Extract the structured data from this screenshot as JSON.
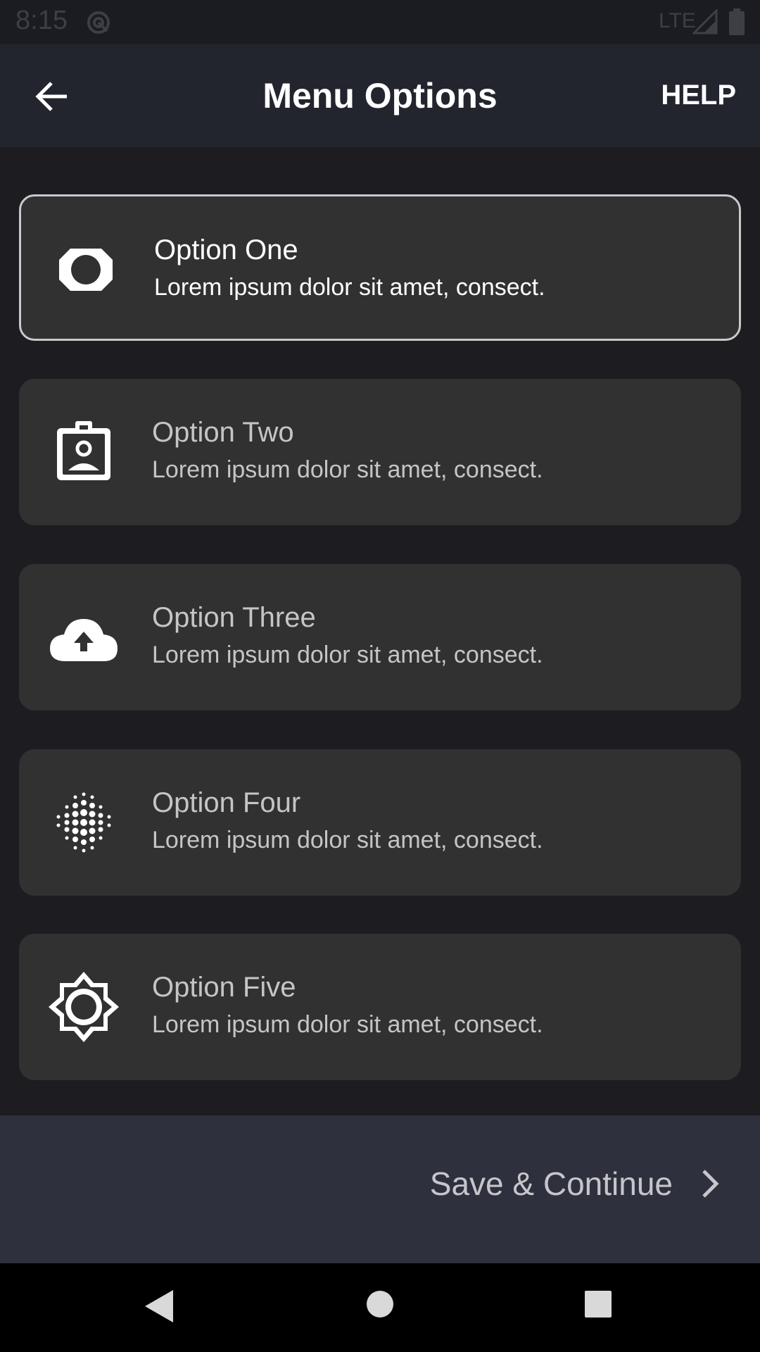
{
  "status_bar": {
    "time": "8:15",
    "network": "LTE"
  },
  "app_bar": {
    "title": "Menu Options",
    "help_label": "HELP"
  },
  "options": [
    {
      "title": "Option One",
      "description": "Lorem ipsum dolor sit amet, consect.",
      "icon": "lens-icon",
      "selected": true
    },
    {
      "title": "Option Two",
      "description": "Lorem ipsum dolor sit amet, consect.",
      "icon": "badge-icon",
      "selected": false
    },
    {
      "title": "Option Three",
      "description": "Lorem ipsum dolor sit amet, consect.",
      "icon": "cloud-upload-icon",
      "selected": false
    },
    {
      "title": "Option Four",
      "description": "Lorem ipsum dolor sit amet, consect.",
      "icon": "blur-dots-icon",
      "selected": false
    },
    {
      "title": "Option Five",
      "description": "Lorem ipsum dolor sit amet, consect.",
      "icon": "brightness-icon",
      "selected": false
    }
  ],
  "action_bar": {
    "save_label": "Save & Continue"
  },
  "colors": {
    "background": "#1c1c21",
    "app_bar": "#23252e",
    "card": "#313131",
    "action_bar": "#2e303e",
    "selected_border": "#c9c9cc"
  }
}
